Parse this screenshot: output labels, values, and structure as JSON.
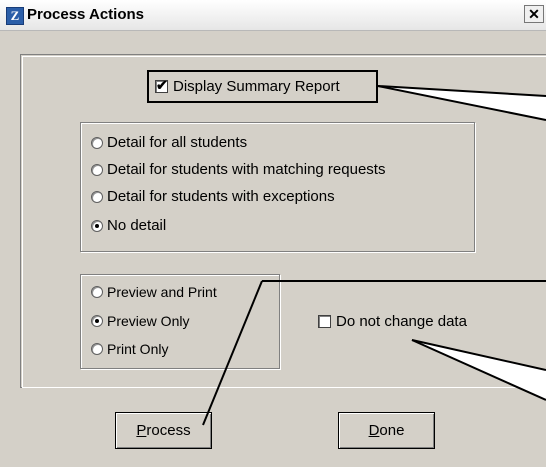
{
  "window": {
    "title": "Process Actions",
    "icon": "Z",
    "close_label": "✕"
  },
  "summary": {
    "label": "Display Summary Report",
    "checked": true
  },
  "detail": {
    "options": [
      {
        "label": "Detail for all students",
        "selected": false
      },
      {
        "label": "Detail for students with matching requests",
        "selected": false
      },
      {
        "label": "Detail for students with exceptions",
        "selected": false
      },
      {
        "label": "No detail",
        "selected": true
      }
    ]
  },
  "output": {
    "options": [
      {
        "label": "Preview and Print",
        "selected": false
      },
      {
        "label": "Preview Only",
        "selected": true
      },
      {
        "label": "Print Only",
        "selected": false
      }
    ]
  },
  "nochange": {
    "label": "Do not change data",
    "checked": false
  },
  "buttons": {
    "process": {
      "first": "P",
      "rest": "rocess"
    },
    "done": {
      "first": "D",
      "rest": "one"
    }
  }
}
